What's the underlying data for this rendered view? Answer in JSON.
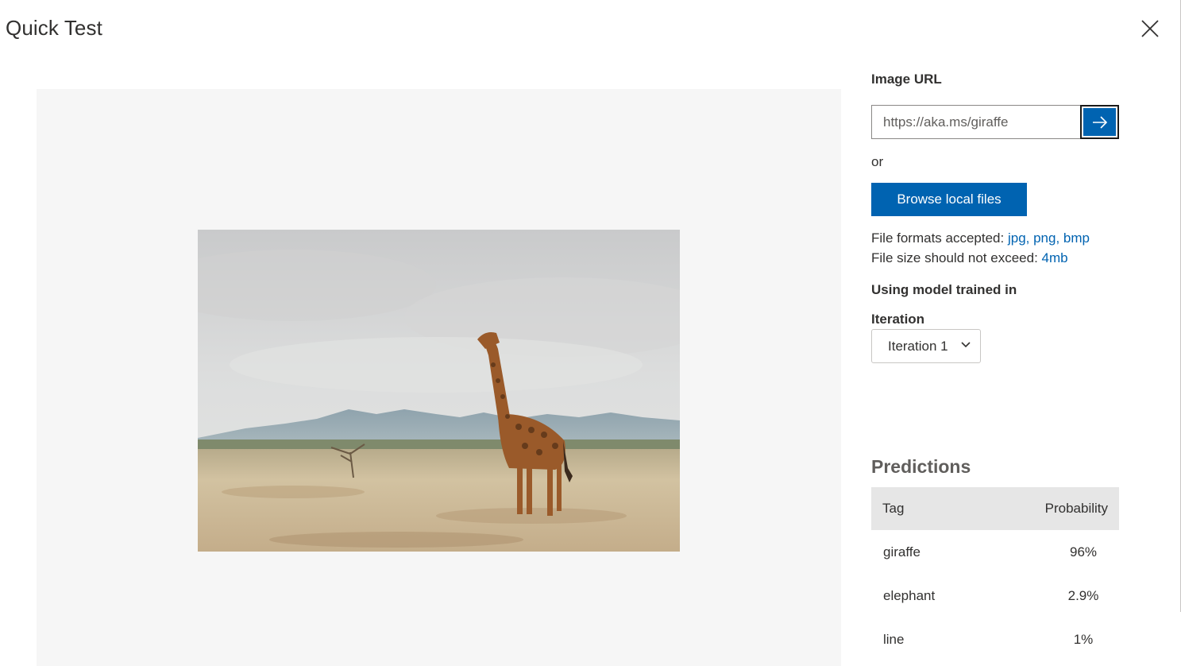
{
  "dialog": {
    "title": "Quick Test"
  },
  "image_url": {
    "label": "Image URL",
    "value": "https://aka.ms/giraffe"
  },
  "or_text": "or",
  "browse": {
    "label": "Browse local files"
  },
  "file_info": {
    "formats_label": "File formats accepted: ",
    "formats_value": "jpg, png, bmp",
    "size_label": "File size should not exceed: ",
    "size_value": "4mb"
  },
  "model": {
    "label": "Using model trained in",
    "iteration_label": "Iteration",
    "iteration_selected": "Iteration 1"
  },
  "predictions": {
    "title": "Predictions",
    "columns": [
      "Tag",
      "Probability"
    ],
    "rows": [
      {
        "tag": "giraffe",
        "probability": "96%"
      },
      {
        "tag": "elephant",
        "probability": "2.9%"
      },
      {
        "tag": "line",
        "probability": "1%"
      }
    ]
  },
  "icons": {
    "close": "close-icon",
    "submit": "arrow-right-icon",
    "dropdown": "chevron-down-icon"
  },
  "colors": {
    "accent": "#0063b1",
    "preview_bg": "#f6f6f6",
    "table_header_bg": "#e6e6e6"
  }
}
